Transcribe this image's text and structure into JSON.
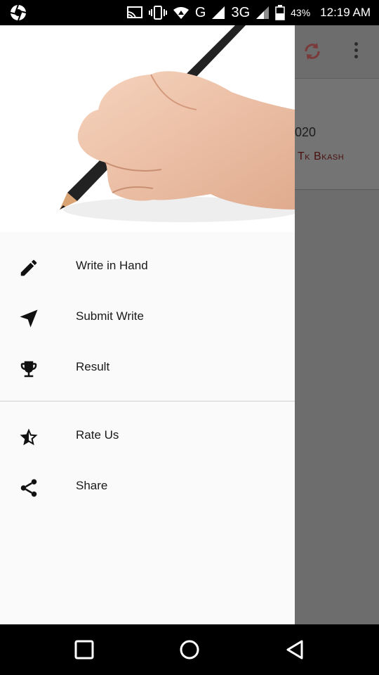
{
  "status_bar": {
    "battery": "43%",
    "time": "12:19 AM",
    "network_g": "G",
    "network_3g": "3G"
  },
  "background_app": {
    "year_fragment": "020",
    "bkash_fragment": "Tk Bkash"
  },
  "drawer": {
    "menu": [
      {
        "label": "Write in Hand",
        "icon": "pencil-icon"
      },
      {
        "label": "Submit Write",
        "icon": "send-icon"
      },
      {
        "label": "Result",
        "icon": "trophy-icon"
      }
    ],
    "secondary_menu": [
      {
        "label": "Rate Us",
        "icon": "star-half-icon"
      },
      {
        "label": "Share",
        "icon": "share-icon"
      }
    ]
  },
  "nav_bar": {
    "buttons": [
      "recents-button",
      "home-button",
      "back-button"
    ]
  },
  "colors": {
    "drawer_bg": "#fafafa",
    "scrim": "#6d6d6d",
    "text": "#1a1a1a",
    "bkash_text": "#4a1010"
  }
}
